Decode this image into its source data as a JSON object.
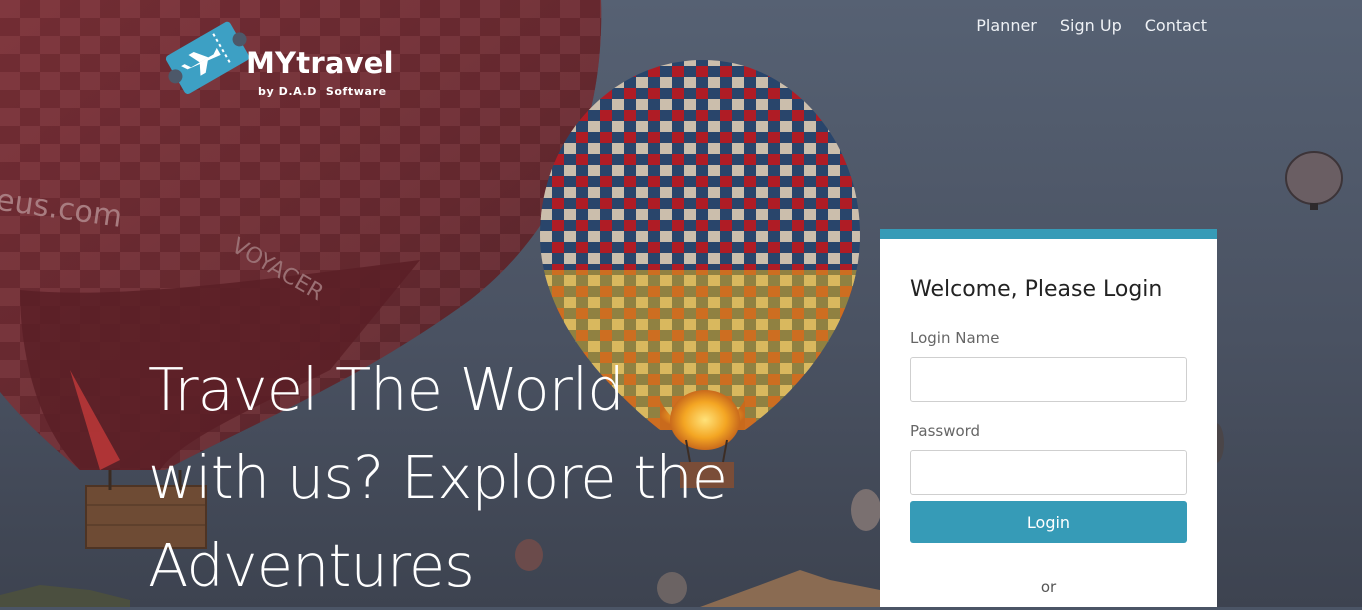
{
  "brand": {
    "name": "MYtravel",
    "tagline": "by D.A.D  Software",
    "logo_icon": "plane-ticket-icon",
    "accent_color": "#369bb7"
  },
  "nav": {
    "items": [
      {
        "label": "Planner"
      },
      {
        "label": "Sign Up"
      },
      {
        "label": "Contact"
      }
    ]
  },
  "hero": {
    "headline": "Travel The World with us? Explore the Adventures",
    "background": "hot-air-balloons-photo"
  },
  "login": {
    "title": "Welcome, Please Login",
    "login_name_label": "Login Name",
    "login_name_value": "",
    "password_label": "Password",
    "password_value": "",
    "button_label": "Login",
    "or_text": "or"
  }
}
